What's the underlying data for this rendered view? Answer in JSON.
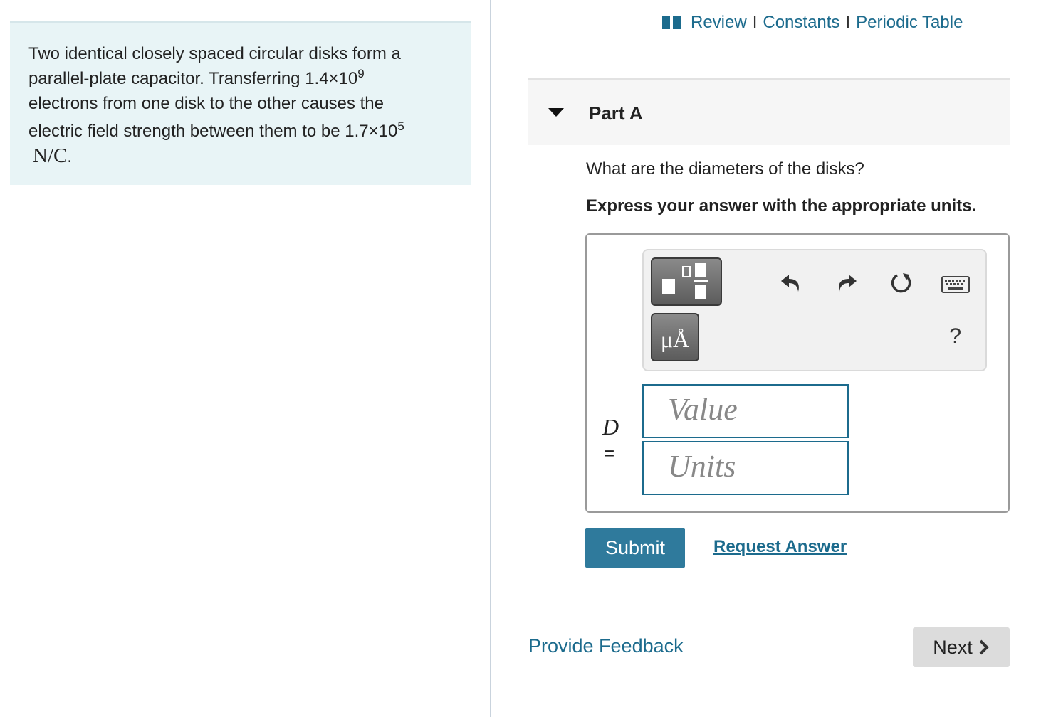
{
  "problem": {
    "line1": "Two identical closely spaced circular disks form a",
    "line2_pre": "parallel-plate capacitor. Transferring 1.4×10",
    "line2_exp": "9",
    "line3": "electrons from one disk to the other causes the",
    "line4_pre": "electric field strength between them to be 1.7×10",
    "line4_exp": "5",
    "unit": "N/C",
    "unit_suffix": "."
  },
  "header": {
    "links": [
      "Review",
      "Constants",
      "Periodic Table"
    ],
    "separator": "I"
  },
  "part": {
    "title": "Part A",
    "question": "What are the diameters of the disks?",
    "instruction": "Express your answer with the appropriate units."
  },
  "answer": {
    "variable": "D",
    "equals": "=",
    "value_placeholder": "Value",
    "units_placeholder": "Units",
    "units_button": "μÅ",
    "help": "?"
  },
  "actions": {
    "submit": "Submit",
    "request_answer": "Request Answer",
    "provide_feedback": "Provide Feedback",
    "next": "Next"
  },
  "colors": {
    "link": "#1c6b8d",
    "submit_bg": "#2f7a9c",
    "problem_bg": "#e8f4f6"
  }
}
